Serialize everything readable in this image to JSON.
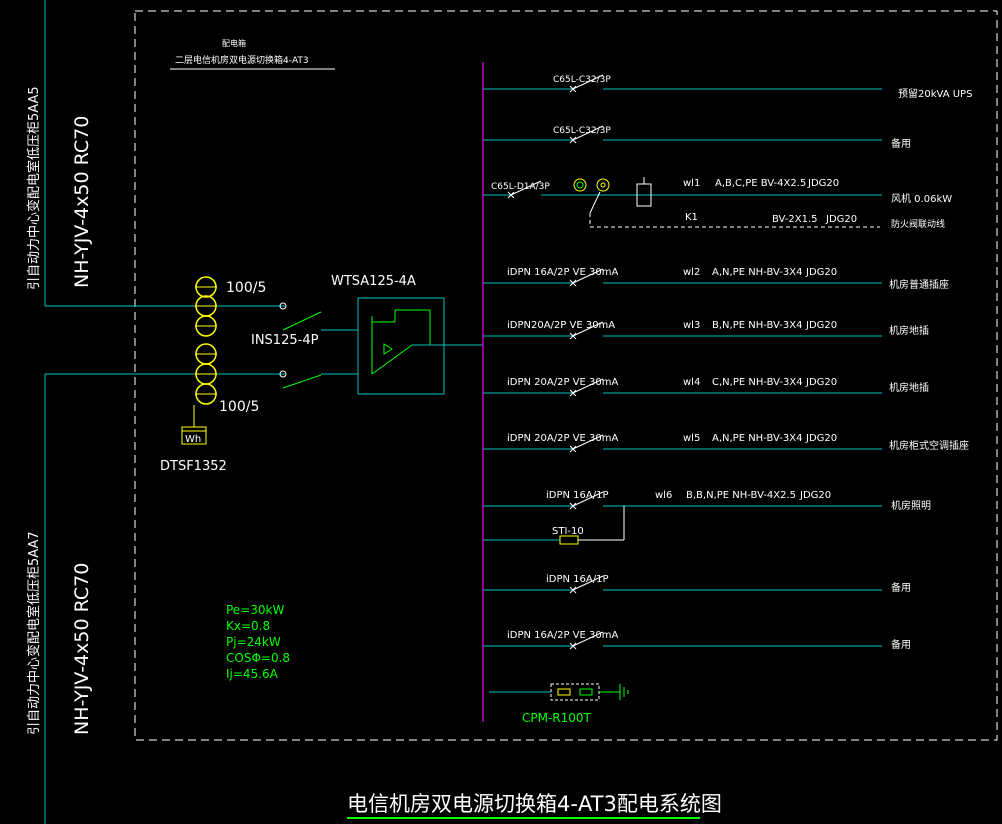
{
  "header": {
    "line1": "配电箱",
    "line2": "二层电信机房双电源切换箱4-AT3"
  },
  "incoming": {
    "feeder1_source": "引自动力中心变配电室低压柜5AA5",
    "feeder1_cable": "NH-YJV-4x50 RC70",
    "feeder2_source": "引自动力中心变配电室低压柜5AA7",
    "feeder2_cable": "NH-YJV-4x50 RC70",
    "ct1": "100/5",
    "ct2": "100/5",
    "switch": "INS125-4P",
    "ats": "WTSA125-4A",
    "meter_symbol": "Wh",
    "meter": "DTSF1352"
  },
  "load_params": [
    "Pe=30kW",
    "Kx=0.8",
    "Pj=24kW",
    "COSΦ=0.8",
    "Ij=45.6A"
  ],
  "circuits": [
    {
      "breaker": "C65L-C32/3P",
      "circuit": "",
      "wire": "",
      "conduit": "",
      "load": "预留20kVA UPS"
    },
    {
      "breaker": "C65L-C32/3P",
      "circuit": "",
      "wire": "",
      "conduit": "",
      "load": "备用"
    },
    {
      "breaker": "C65L-D1A/3P",
      "circuit": "wl1",
      "wire": "A,B,C,PE BV-4X2.5",
      "conduit": "JDG20",
      "load": "风机 0.06kW"
    },
    {
      "breaker": "iDPN 16A/2P VE 30mA",
      "circuit": "wl2",
      "wire": "A,N,PE NH-BV-3X4",
      "conduit": "JDG20",
      "load": "机房普通插座"
    },
    {
      "breaker": "iDPN20A/2P VE 30mA",
      "circuit": "wl3",
      "wire": "B,N,PE NH-BV-3X4",
      "conduit": "JDG20",
      "load": "机房地插"
    },
    {
      "breaker": "iDPN 20A/2P VE 30mA",
      "circuit": "wl4",
      "wire": "C,N,PE NH-BV-3X4",
      "conduit": "JDG20",
      "load": "机房地插"
    },
    {
      "breaker": "iDPN 20A/2P VE 30mA",
      "circuit": "wl5",
      "wire": "A,N,PE NH-BV-3X4",
      "conduit": "JDG20",
      "load": "机房柜式空调插座"
    },
    {
      "breaker": "iDPN 16A/1P",
      "circuit": "wl6",
      "wire": "B,B,N,PE NH-BV-4X2.5",
      "conduit": "JDG20",
      "load": "机房照明"
    },
    {
      "breaker": "iDPN 16A/1P",
      "circuit": "",
      "wire": "",
      "conduit": "",
      "load": "备用"
    },
    {
      "breaker": "iDPN 16A/2P VE 30mA",
      "circuit": "",
      "wire": "",
      "conduit": "",
      "load": "备用"
    }
  ],
  "fan_control": {
    "label": "K1",
    "wire": "BV-2X1.5",
    "conduit": "JDG20",
    "load": "防火阀联动线"
  },
  "timer": "STI-10",
  "spd": "CPM-R100T",
  "title": "电信机房双电源切换箱4-AT3配电系统图",
  "colors": {
    "background": "#000000",
    "frame": "#ffffff",
    "busbar": "#c000c0",
    "wire": "#00c0c0",
    "device": "#ffff00",
    "green": "#00ff00",
    "text": "#ffffff"
  }
}
